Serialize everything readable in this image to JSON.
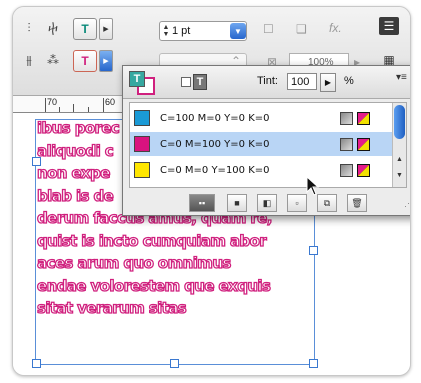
{
  "toolbar": {
    "stroke_weight_value": "1 pt",
    "zoom_value": "100%",
    "fx_label": "fx."
  },
  "ruler": {
    "labels": [
      "70",
      "60"
    ]
  },
  "canvas": {
    "text_lines": [
      "ibus porec",
      "aliquodi c",
      "non expe",
      "blab is de             mnimus sam",
      "derum faccus amus, quam re,",
      "quist is incto cumquiam abor",
      "aces arum quo omnimus",
      "endae volorestem que exquis",
      "sitat verarum sitas"
    ]
  },
  "swatches_panel": {
    "tint_label": "Tint:",
    "tint_value": "100",
    "percent_label": "%",
    "menu_icon": "≡",
    "swatches": [
      {
        "name": "C=100 M=0 Y=0 K=0",
        "color": "#1a9ad6",
        "selected": false
      },
      {
        "name": "C=0 M=100 Y=0 K=0",
        "color": "#d9137f",
        "selected": true
      },
      {
        "name": "C=0 M=0 Y=100 K=0",
        "color": "#ffe600",
        "selected": false
      }
    ]
  }
}
